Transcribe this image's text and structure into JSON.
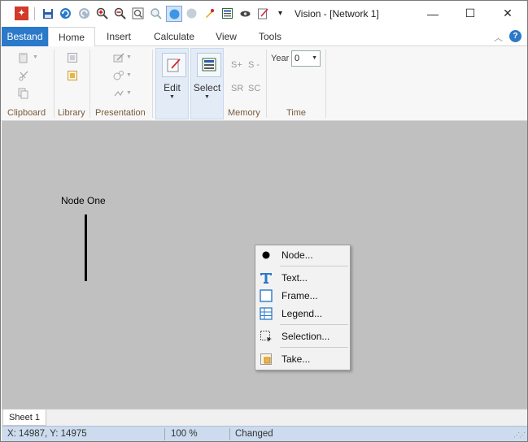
{
  "window": {
    "title": "Vision - [Network 1]",
    "minimize_glyph": "—",
    "maximize_glyph": "☐",
    "close_glyph": "✕"
  },
  "quick_access": {
    "more_glyph": "▾"
  },
  "ribbon_tabs": {
    "file": "Bestand",
    "items": [
      "Home",
      "Insert",
      "Calculate",
      "View",
      "Tools"
    ],
    "active": "Home"
  },
  "ribbon": {
    "groups": {
      "clipboard": "Clipboard",
      "library": "Library",
      "presentation": "Presentation",
      "memory": "Memory",
      "time": "Time"
    },
    "edit_label": "Edit",
    "select_label": "Select",
    "memory_buttons": [
      "S+",
      "S -",
      "SR",
      "SC"
    ],
    "year_label": "Year",
    "year_value": "0"
  },
  "canvas": {
    "node_label": "Node One"
  },
  "context_menu": {
    "items": [
      {
        "label": "Node...",
        "icon": "dot-icon"
      },
      {
        "label": "Text...",
        "icon": "text-icon"
      },
      {
        "label": "Frame...",
        "icon": "frame-icon"
      },
      {
        "label": "Legend...",
        "icon": "legend-icon"
      },
      {
        "label": "Selection...",
        "icon": "selection-icon"
      },
      {
        "label": "Take...",
        "icon": "take-icon"
      }
    ]
  },
  "sheets": {
    "active": "Sheet 1"
  },
  "status": {
    "coords": "X: 14987, Y: 14975",
    "zoom": "100 %",
    "state": "Changed"
  },
  "colors": {
    "accent": "#2b79c9",
    "canvas": "#c0c0c0",
    "status_bar": "#ccdcee"
  }
}
